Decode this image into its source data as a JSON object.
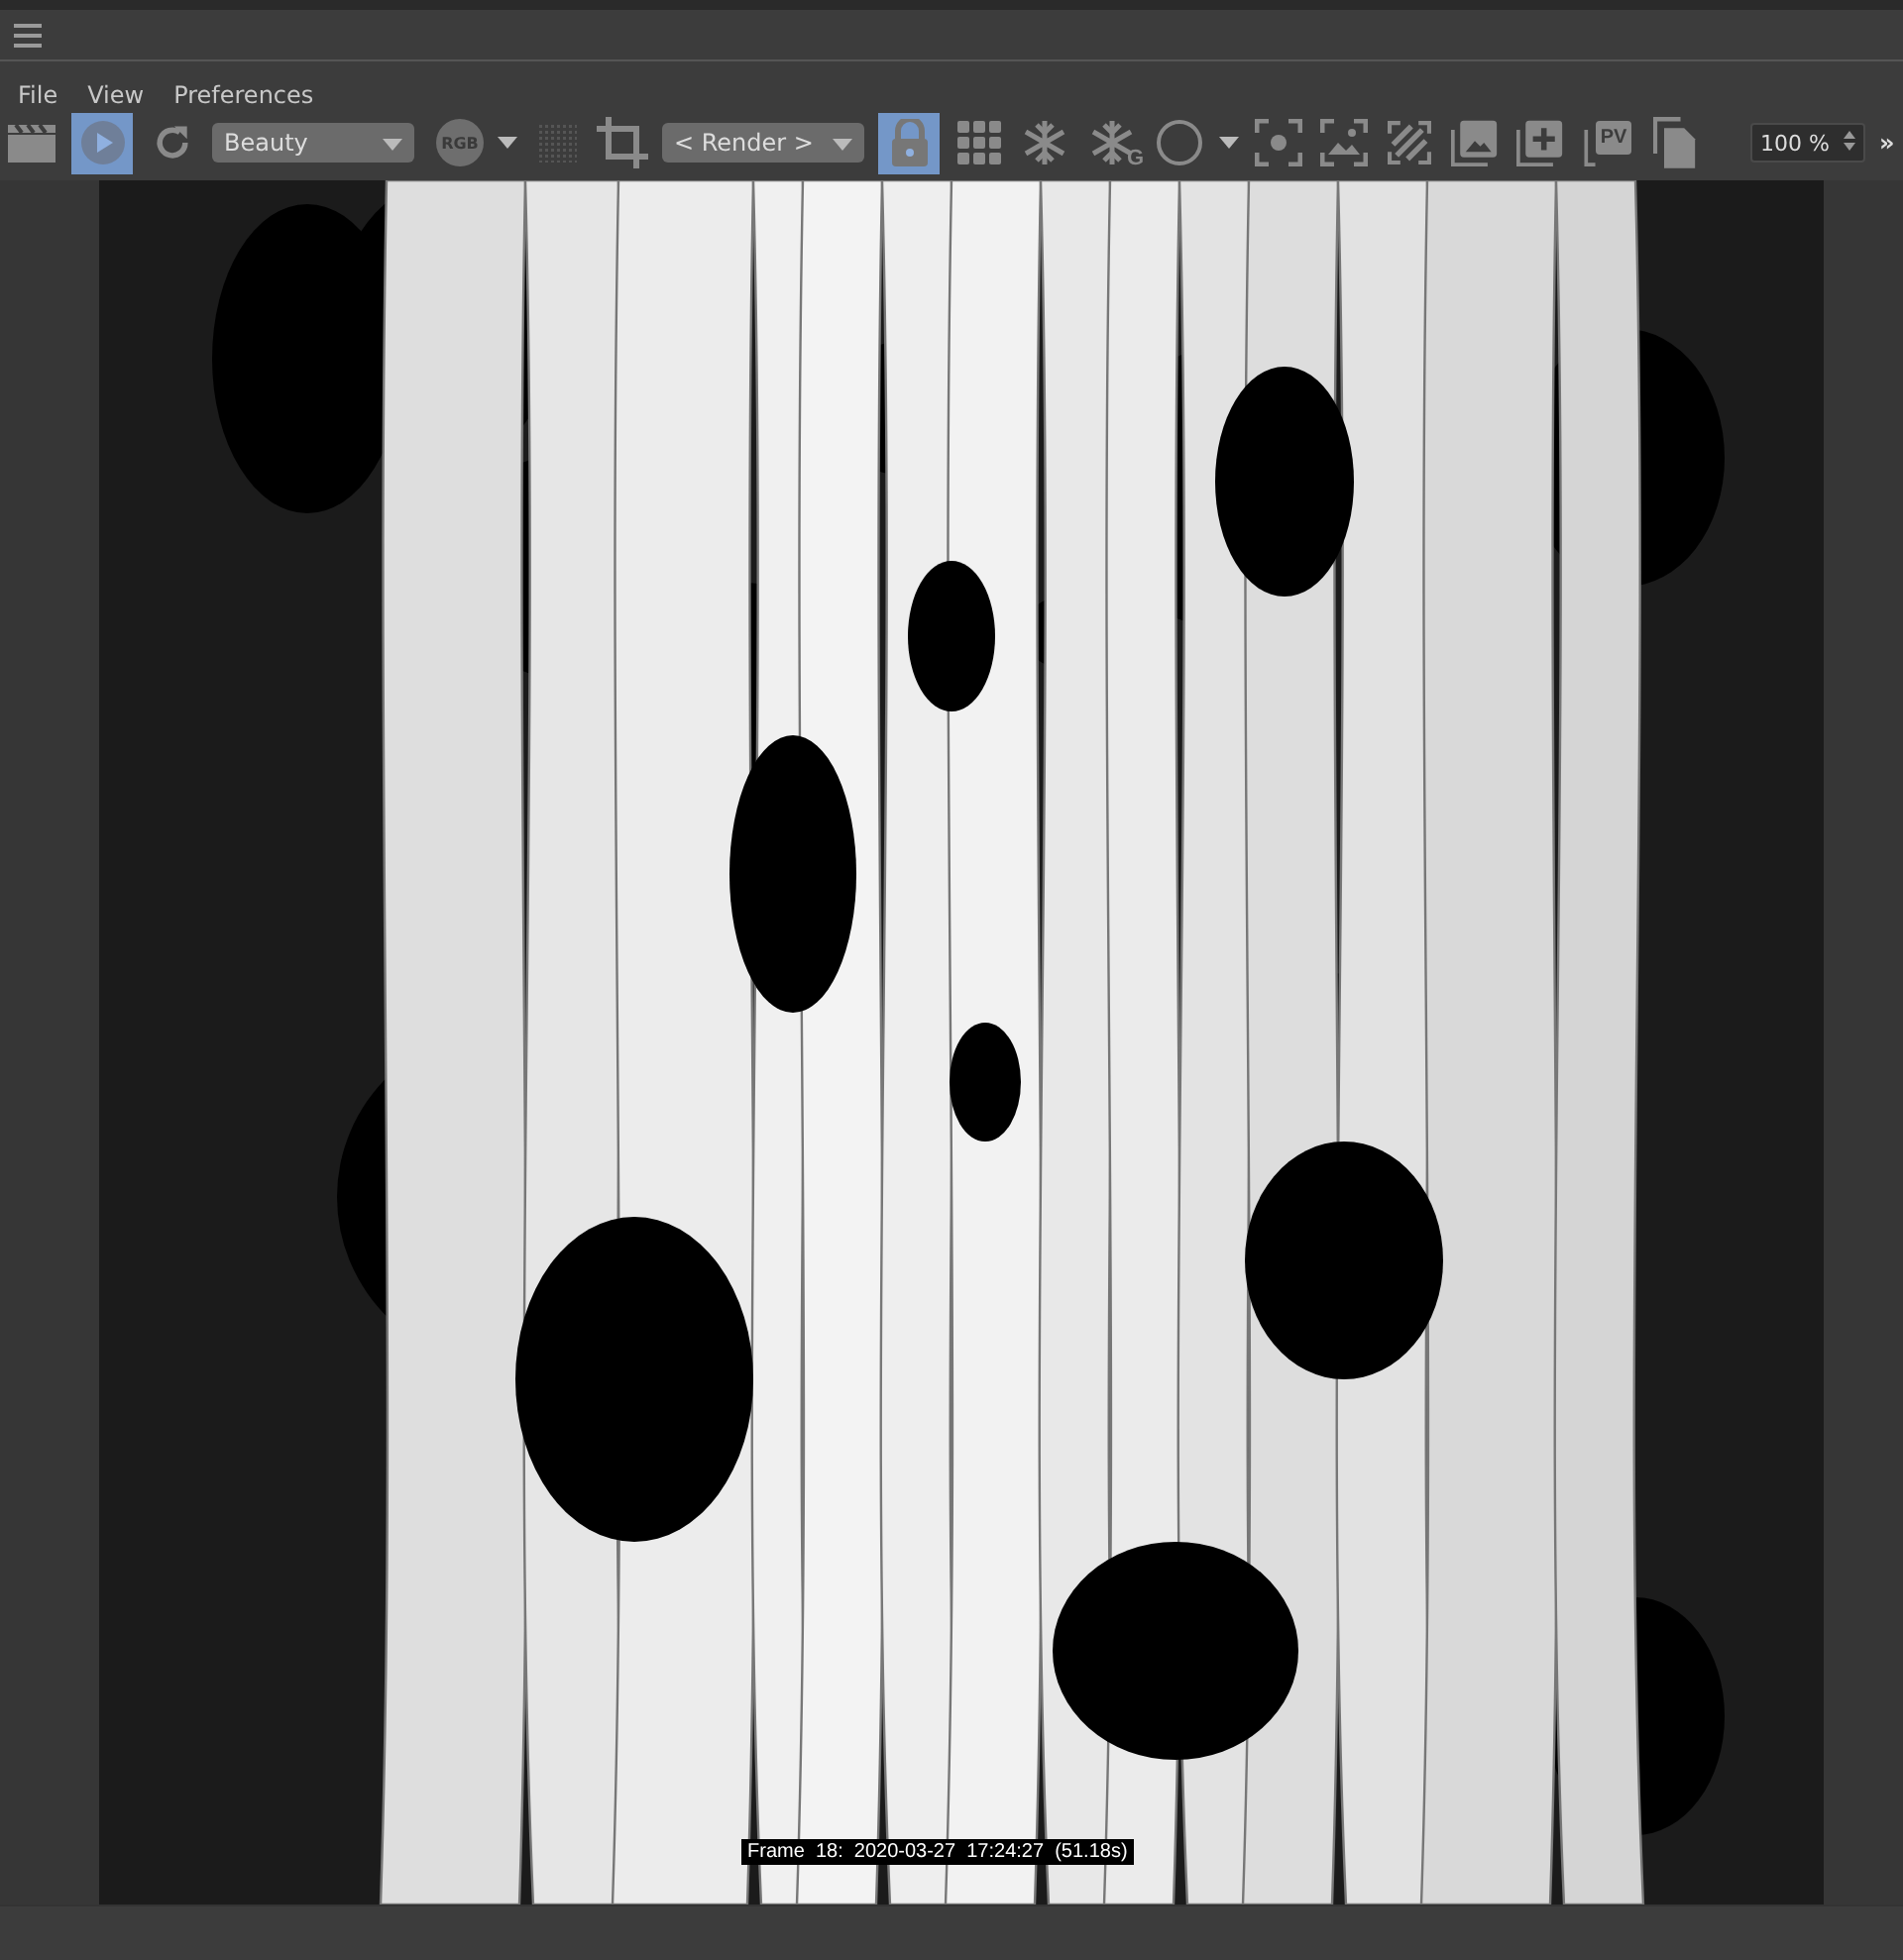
{
  "menu": [
    {
      "label": "File"
    },
    {
      "label": "View"
    },
    {
      "label": "Preferences"
    }
  ],
  "toolbar": [
    {
      "kind": "button",
      "active": false
    },
    {
      "kind": "button",
      "active": true
    },
    {
      "kind": "button",
      "active": false
    },
    {
      "kind": "dropdown",
      "value": "Beauty"
    },
    {
      "kind": "badge",
      "label": "RGB"
    },
    {
      "kind": "button",
      "active": false
    },
    {
      "kind": "button",
      "active": false
    },
    {
      "kind": "button",
      "active": false
    },
    {
      "kind": "dropdown",
      "value": "< Render >"
    },
    {
      "kind": "button",
      "active": true
    },
    {
      "kind": "button",
      "active": false
    },
    {
      "kind": "button",
      "active": false
    },
    {
      "kind": "lettered",
      "label": "G"
    },
    {
      "kind": "button",
      "active": false
    },
    {
      "kind": "button",
      "active": false
    },
    {
      "kind": "button",
      "active": false
    },
    {
      "kind": "button",
      "active": false
    },
    {
      "kind": "button",
      "active": false
    },
    {
      "kind": "button",
      "active": false
    },
    {
      "kind": "button",
      "active": false
    },
    {
      "kind": "lettered",
      "label": "PV"
    },
    {
      "kind": "button",
      "active": false
    }
  ],
  "zoom": {
    "value": "100 %"
  },
  "overflow": "»",
  "render": {
    "frame_info": "Frame  18:  2020-03-27  17:24:27  (51.18s)"
  }
}
